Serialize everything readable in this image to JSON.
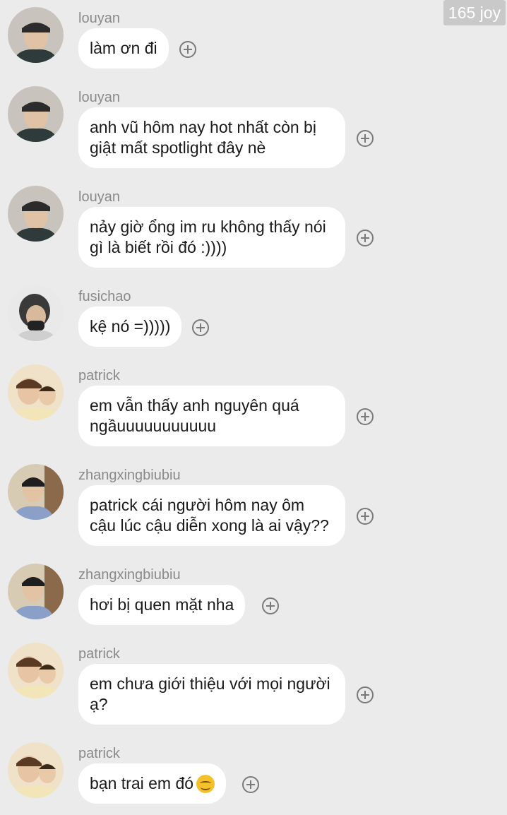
{
  "watermark": "165 joy",
  "messages": [
    {
      "user": "louyan",
      "avatar": "louyan-avatar",
      "text": "làm ơn đi"
    },
    {
      "user": "louyan",
      "avatar": "louyan-avatar",
      "text": "anh vũ hôm nay hot nhất còn bị giật mất spotlight đây nè"
    },
    {
      "user": "louyan",
      "avatar": "louyan-avatar",
      "text": "nảy giờ ổng im ru không thấy nói gì là biết rồi đó :))))"
    },
    {
      "user": "fusichao",
      "avatar": "fusichao-avatar",
      "text": "kệ nó =)))))"
    },
    {
      "user": "patrick",
      "avatar": "patrick-avatar",
      "text": "em vẫn thấy anh nguyên quá ngầuuuuuuuuuuu"
    },
    {
      "user": "zhangxingbiubiu",
      "avatar": "zhangxingbiubiu-avatar",
      "text": "patrick cái người hôm nay ôm cậu lúc cậu diễn xong là ai vậy??"
    },
    {
      "user": "zhangxingbiubiu",
      "avatar": "zhangxingbiubiu-avatar",
      "text": "hơi bị quen mặt nha"
    },
    {
      "user": "patrick",
      "avatar": "patrick-avatar",
      "text": "em chưa giới thiệu với mọi người ạ?"
    },
    {
      "user": "patrick",
      "avatar": "patrick-avatar",
      "text": "bạn trai em đó",
      "emoji": "smiling-face-emoji"
    }
  ]
}
